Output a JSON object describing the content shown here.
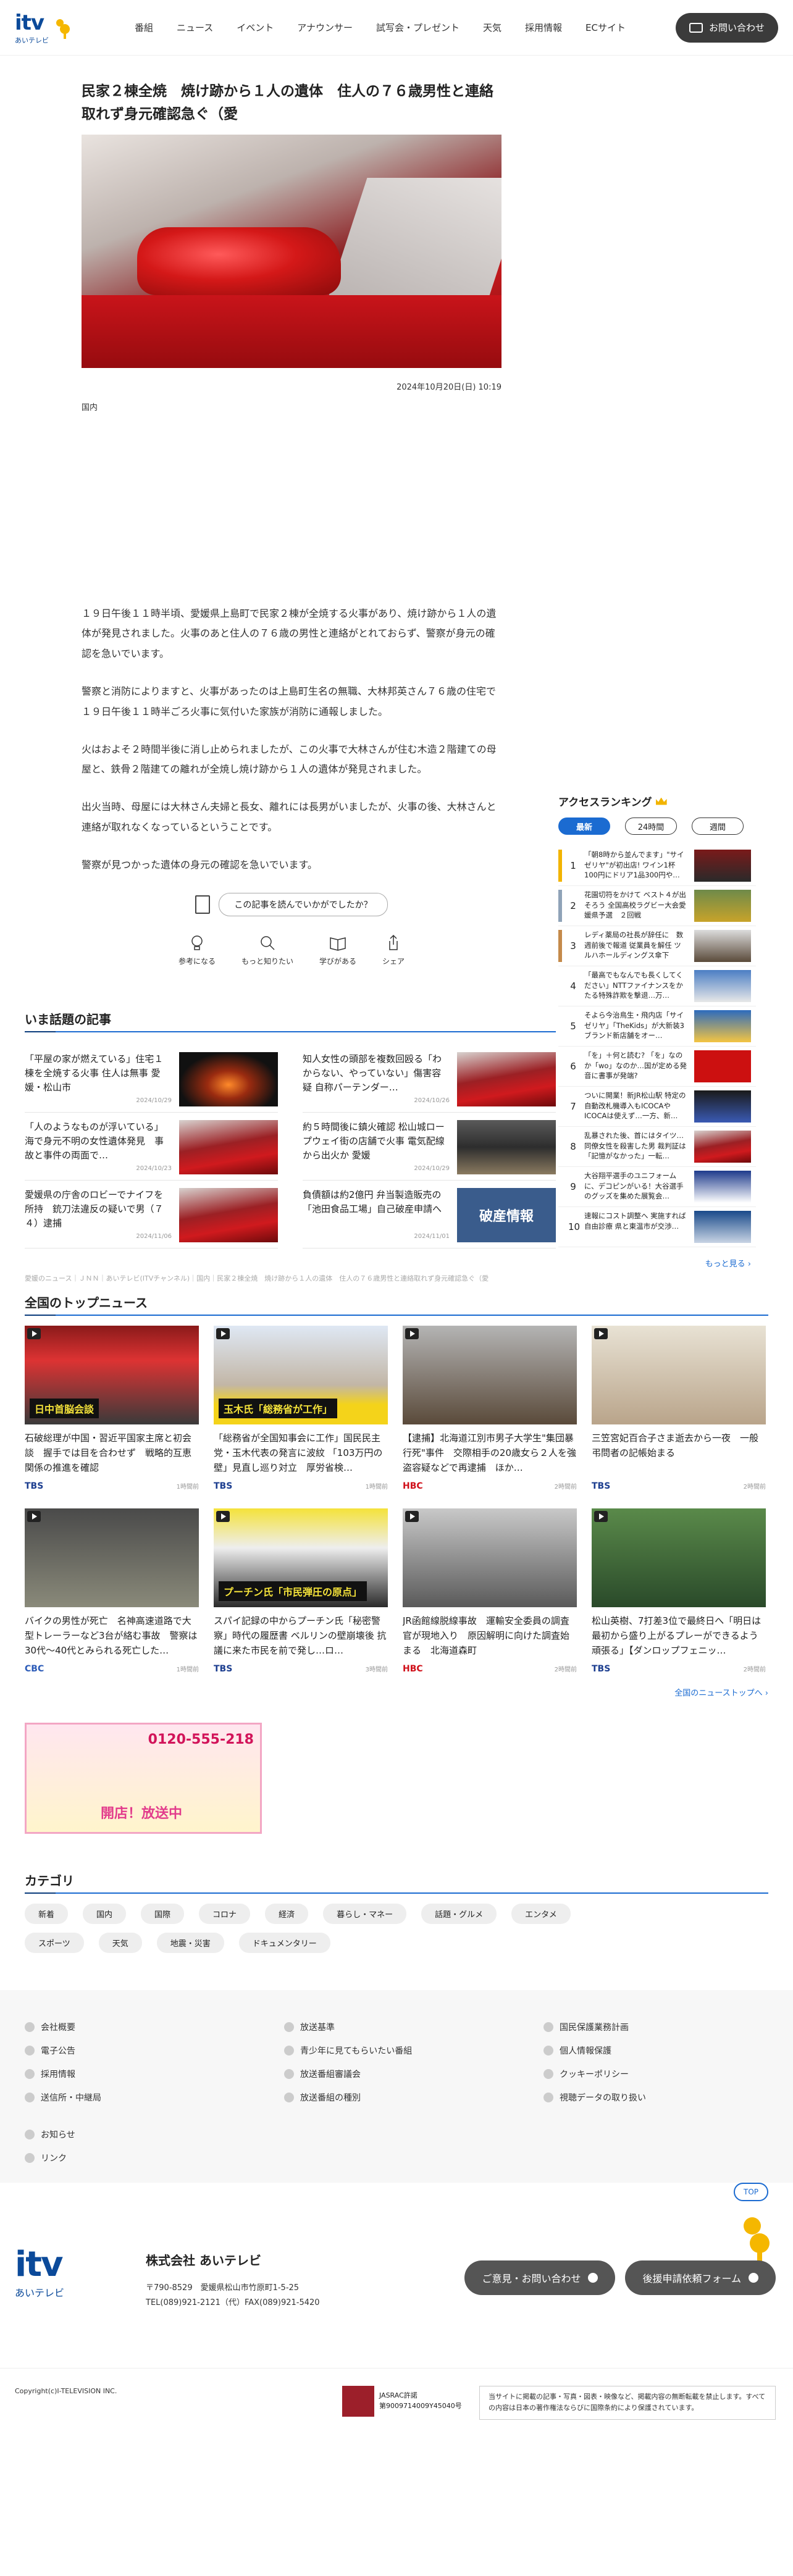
{
  "header": {
    "logo_text": "itv",
    "logo_sub": "あいテレビ",
    "nav": [
      "番組",
      "ニュース",
      "イベント",
      "アナウンサー",
      "試写会・プレゼント",
      "天気",
      "採用情報",
      "ECサイト"
    ],
    "contact_label": "お問い合わせ"
  },
  "article": {
    "title": "民家２棟全焼　焼け跡から１人の遺体　住人の７６歳男性と連絡取れず身元確認急ぐ（愛",
    "date": "2024年10月20日(日) 10:19",
    "category": "国内",
    "paragraphs": [
      "１９日午後１１時半頃、愛媛県上島町で民家２棟が全焼する火事があり、焼け跡から１人の遺体が発見されました。火事のあと住人の７６歳の男性と連絡がとれておらず、警察が身元の確認を急いでいます。",
      "警察と消防によりますと、火事があったのは上島町生名の無職、大林邦英さん７６歳の住宅で１９日午後１１時半ごろ火事に気付いた家族が消防に通報しました。",
      "火はおよそ２時間半後に消し止められましたが、この火事で大林さんが住む木造２階建ての母屋と、鉄骨２階建ての離れが全焼し焼け跡から１人の遺体が発見されました。",
      "出火当時、母屋には大林さん夫婦と長女、離れには長男がいましたが、火事の後、大林さんと連絡が取れなくなっているということです。",
      "警察が見つかった遺体の身元の確認を急いでいます。"
    ],
    "feedback_prompt": "この記事を読んでいかがでしたか？",
    "feedback_icons": [
      {
        "label": "参考になる",
        "icon": "lightbulb-icon"
      },
      {
        "label": "もっと知りたい",
        "icon": "search-icon"
      },
      {
        "label": "学びがある",
        "icon": "book-icon"
      },
      {
        "label": "シェア",
        "icon": "share-icon"
      }
    ]
  },
  "wadai": {
    "heading": "いま話題の記事",
    "items": [
      {
        "title": "「平屋の家が燃えている」住宅１棟を全焼する火事 住人は無事 愛媛・松山市",
        "date": "2024/10/29",
        "thumb": "night-fire"
      },
      {
        "title": "知人女性の頭部を複数回殴る「わからない、やっていない」傷害容疑 自称パーテンダー…",
        "date": "2024/10/26",
        "thumb": "siren"
      },
      {
        "title": "「人のようなものが浮いている」海で身元不明の女性遺体発見　事故と事件の両面で…",
        "date": "2024/10/23",
        "thumb": "siren"
      },
      {
        "title": "約５時間後に鎮火確認 松山城ロープウェイ街の店舗で火事 電気配線から出火か 愛媛",
        "date": "2024/10/29",
        "thumb": "street"
      },
      {
        "title": "愛媛県の庁舎のロビーでナイフを所持　銃刀法違反の疑いで男（７４）逮捕",
        "date": "2024/11/06",
        "thumb": "siren"
      },
      {
        "title": "負債額は約2億円 弁当製造販売の「池田食品工場」自己破産申請へ",
        "date": "2024/11/01",
        "thumb": "bankruptcy"
      }
    ],
    "bankruptcy_text": "破産情報"
  },
  "breadcrumb": "愛媛のニュース｜ＪＮＮ｜あいテレビ(ITVチャンネル)｜国内｜民家２棟全焼　焼け跡から１人の遺体　住人の７６歳男性と連絡取れず身元確認急ぐ（愛",
  "ranking": {
    "heading": "アクセスランキング",
    "tabs": [
      "最新",
      "24時間",
      "週間"
    ],
    "items": [
      {
        "rank": "1",
        "title": "「朝8時から並んでます」\"サイゼリヤ\"が初出店! ワイン1杯100円にドリア1品300円や…",
        "color": "#f2b400",
        "thumb": "store"
      },
      {
        "rank": "2",
        "title": "花園切符をかけて ベスト４が出そろう 全国高校ラグビー大会愛媛県予選　２回戦",
        "color": "#8fa3b8",
        "thumb": "rugby"
      },
      {
        "rank": "3",
        "title": "レディ薬局の社長が辞任に　数週前後で報道 従業員を解任 ツルハホールディングス傘下",
        "color": "#c48a4a",
        "thumb": "person"
      },
      {
        "rank": "4",
        "title": "「最高でもなんでも長くしてください」NTTファイナンスをかたる特殊詐欺を撃退…万…",
        "color": "#ffffff",
        "thumb": "shop"
      },
      {
        "rank": "5",
        "title": "そよら今治鳥生・飛内店「サイゼリヤ」「TheKids」が大新装3ブランド新店舗をオー…",
        "color": "#ffffff",
        "thumb": "signs"
      },
      {
        "rank": "6",
        "title": "「を」＋何と読む? 「を」なのか「wo」なのか…国が定める発音に書事が発端?",
        "color": "#ffffff",
        "thumb": "wo"
      },
      {
        "rank": "7",
        "title": "ついに開業！新JR松山駅 特定の自動改札機導入もICOCAやICOCAは使えず…一方、新…",
        "color": "#ffffff",
        "thumb": "station"
      },
      {
        "rank": "8",
        "title": "乱暴された後、首にはタイツ…同僚女性を殺害した男 裁判証は「記憶がなかった」一転…",
        "color": "#ffffff",
        "thumb": "siren"
      },
      {
        "rank": "9",
        "title": "大谷翔平選手のユニフォームに、デコピンがいる！大谷選手のグッズを集めた展覧会…",
        "color": "#ffffff",
        "thumb": "baseball"
      },
      {
        "rank": "10",
        "title": "速報にコスト調整へ 実施すれば自由診療 県と東温市が交渉…",
        "color": "#ffffff",
        "thumb": "news"
      }
    ],
    "more_label": "もっと見る"
  },
  "topnews": {
    "heading": "全国のトップニュース",
    "items": [
      {
        "title": "石破総理が中国・習近平国家主席と初会談　握手では目を合わせず　戦略的互恵関係の推進を確認",
        "source": "TBS",
        "ago": "1時間前",
        "thumb": "summit",
        "src_color": "#1b3d8f"
      },
      {
        "title": "「総務省が全国知事会に工作」国民民主党・玉木代表の発言に波紋 「103万円の壁」見直し巡り対立　厚労省検…",
        "source": "TBS",
        "ago": "1時間前",
        "thumb": "tamaki",
        "src_color": "#1b3d8f"
      },
      {
        "title": "【逮捕】北海道江別市男子大学生\"集団暴行死\"事件　交際相手の20歳女ら２人を強盗容疑などで再逮捕　ほか…",
        "source": "HBC",
        "ago": "2時間前",
        "thumb": "people",
        "src_color": "#d0101a"
      },
      {
        "title": "三笠宮妃百合子さま逝去から一夜　一般弔問者の記帳始まる",
        "source": "TBS",
        "ago": "2時間前",
        "thumb": "elder",
        "src_color": "#1b3d8f"
      },
      {
        "title": "バイクの男性が死亡　名神高速道路で大型トレーラーなど3台が絡む事故　警察は30代〜40代とみられる死亡した…",
        "source": "CBC",
        "ago": "1時間前",
        "thumb": "accident",
        "src_color": "#2b5bb8"
      },
      {
        "title": "スパイ記録の中からプーチン氏「秘密警察」時代の履歴書 ベルリンの壁崩壊後 抗議に来た市民を前で発し…ロ…",
        "source": "TBS",
        "ago": "3時間前",
        "thumb": "putin",
        "src_color": "#1b3d8f"
      },
      {
        "title": "JR函館線脱線事故　運輸安全委員の調査官が現地入り　原因解明に向けた調査始まる　北海道森町",
        "source": "HBC",
        "ago": "2時間前",
        "thumb": "rail",
        "src_color": "#d0101a"
      },
      {
        "title": "松山英樹、7打差3位で最終日へ「明日は最初から盛り上がるプレーができるよう頑張る」【ダンロップフェニッ…",
        "source": "TBS",
        "ago": "2時間前",
        "thumb": "golfer",
        "src_color": "#1b3d8f"
      }
    ],
    "tamaki_caption": "玉木氏「総務省が工作」",
    "putin_caption": "プーチン氏「市民弾圧の原点」",
    "summit_caption": "日中首脳会談",
    "more_label": "全国のニューストップへ"
  },
  "banner": {
    "phone": "0120-555-218",
    "open_text": "開店！放送中"
  },
  "categories": {
    "heading": "カテゴリ",
    "items": [
      "新着",
      "国内",
      "国際",
      "コロナ",
      "経済",
      "暮らし・マネー",
      "話題・グルメ",
      "エンタメ",
      "スポーツ",
      "天気",
      "地震・災害",
      "ドキュメンタリー"
    ]
  },
  "footer_links": {
    "columns": [
      [
        "会社概要",
        "電子公告",
        "採用情報",
        "送信所・中継局"
      ],
      [
        "放送基準",
        "青少年に見てもらいたい番組",
        "放送番組審議会",
        "放送番組の種別"
      ],
      [
        "国民保護業務計画",
        "個人情報保護",
        "クッキーポリシー",
        "視聴データの取り扱い"
      ]
    ],
    "extra": [
      "お知らせ",
      "リンク"
    ]
  },
  "footer": {
    "top_label": "TOP",
    "logo_text": "itv",
    "logo_sub": "あいテレビ",
    "company": "株式会社 あいテレビ",
    "zip_addr": "〒790-8529　愛媛県松山市竹原町1-5-25",
    "tel": "TEL(089)921-2121（代）FAX(089)921-5420",
    "btn_contact": "ご意見・お問い合わせ",
    "btn_apply": "後援申請依頼フォーム",
    "copyright": "Copyright(c)I-TELEVISION INC.",
    "jasrac_title": "JASRAC許諾",
    "jasrac_no": "第9009714009Y45040号",
    "rights_text": "当サイトに掲載の記事・写真・図表・映像など、掲載内容の無断転載を禁止します。すべての内容は日本の著作権法ならびに国際条約により保護されています。"
  }
}
